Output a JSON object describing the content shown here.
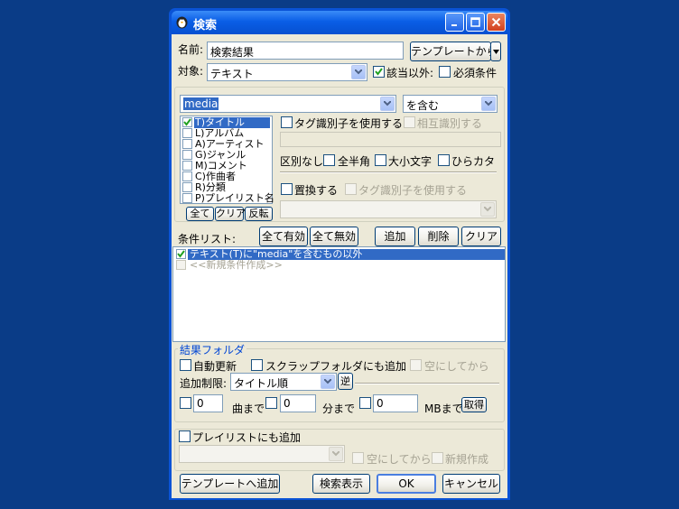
{
  "window": {
    "title": "検索",
    "buttons": {
      "minimize": "_",
      "maximize": "□",
      "close": "✕"
    }
  },
  "name_row": {
    "label": "名前:",
    "value": "検索結果",
    "template_button": "テンプレートから",
    "template_arrow": "▾"
  },
  "target_row": {
    "label": "対象:",
    "value": "テキスト",
    "exclude_label": "該当以外:",
    "required_label": "必須条件"
  },
  "condition": {
    "keyword": "media",
    "match_mode": "を含む",
    "fields": [
      "T)タイトル",
      "L)アルバム",
      "A)アーティスト",
      "G)ジャンル",
      "M)コメント",
      "C)作曲者",
      "R)分類",
      "P)プレイリスト名"
    ],
    "field_buttons": {
      "all": "全て",
      "clear": "クリア",
      "invert": "反転"
    },
    "use_tag_id": "タグ識別子を使用する",
    "mutual_id": "相互識別する",
    "no_distinction_label": "区別なし:",
    "full_half": "全半角",
    "case": "大小文字",
    "hiragana": "ひらカタ",
    "replace": "置換する",
    "replace_tag_id": "タグ識別子を使用する"
  },
  "condition_list": {
    "label": "条件リスト:",
    "buttons": {
      "enable_all": "全て有効",
      "disable_all": "全て無効",
      "add": "追加",
      "delete": "削除",
      "clear": "クリア"
    },
    "items": [
      "テキスト(T)に\"media\"を含むもの以外",
      "<<新規条件作成>>"
    ]
  },
  "result_folder": {
    "legend": "結果フォルダ",
    "auto_update": "自動更新",
    "add_scrap": "スクラップフォルダにも追加",
    "empty_first": "空にしてから",
    "limit_label": "追加制限:",
    "limit_value": "タイトル順",
    "reverse_button": "逆",
    "songs_value": "0",
    "songs_unit": "曲まで",
    "minutes_value": "0",
    "minutes_unit": "分まで",
    "mb_value": "0",
    "mb_unit": "MBまで",
    "get_button": "取得"
  },
  "playlist": {
    "add_label": "プレイリストにも追加",
    "empty_first": "空にしてから",
    "new_create": "新規作成"
  },
  "footer": {
    "add_template": "テンプレートへ追加",
    "show_search": "検索表示",
    "ok": "OK",
    "cancel": "キャンセル"
  }
}
